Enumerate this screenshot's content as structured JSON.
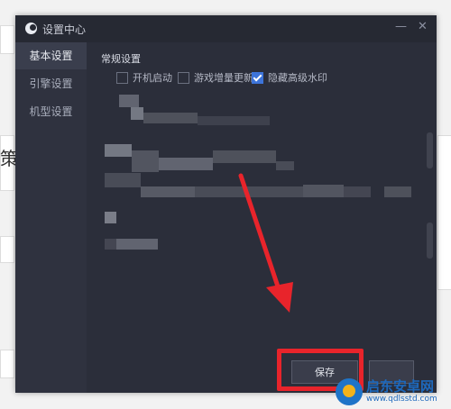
{
  "window": {
    "title": "设置中心",
    "minimize_icon": "minimize-icon",
    "close_icon": "close-icon"
  },
  "sidebar": {
    "items": [
      {
        "label": "基本设置",
        "active": true
      },
      {
        "label": "引擎设置",
        "active": false
      },
      {
        "label": "机型设置",
        "active": false
      }
    ]
  },
  "general": {
    "section_title": "常规设置",
    "options": [
      {
        "label": "开机启动",
        "checked": false
      },
      {
        "label": "游戏增量更新",
        "checked": false
      },
      {
        "label": "隐藏高级水印",
        "checked": true
      }
    ]
  },
  "footer": {
    "save_label": "保存"
  },
  "background": {
    "partial_text": "策"
  },
  "watermark": {
    "main": "启东安卓网",
    "url": "www.qdlsstd.com"
  },
  "colors": {
    "accent": "#3d74d9",
    "annotation": "#e8242b"
  }
}
